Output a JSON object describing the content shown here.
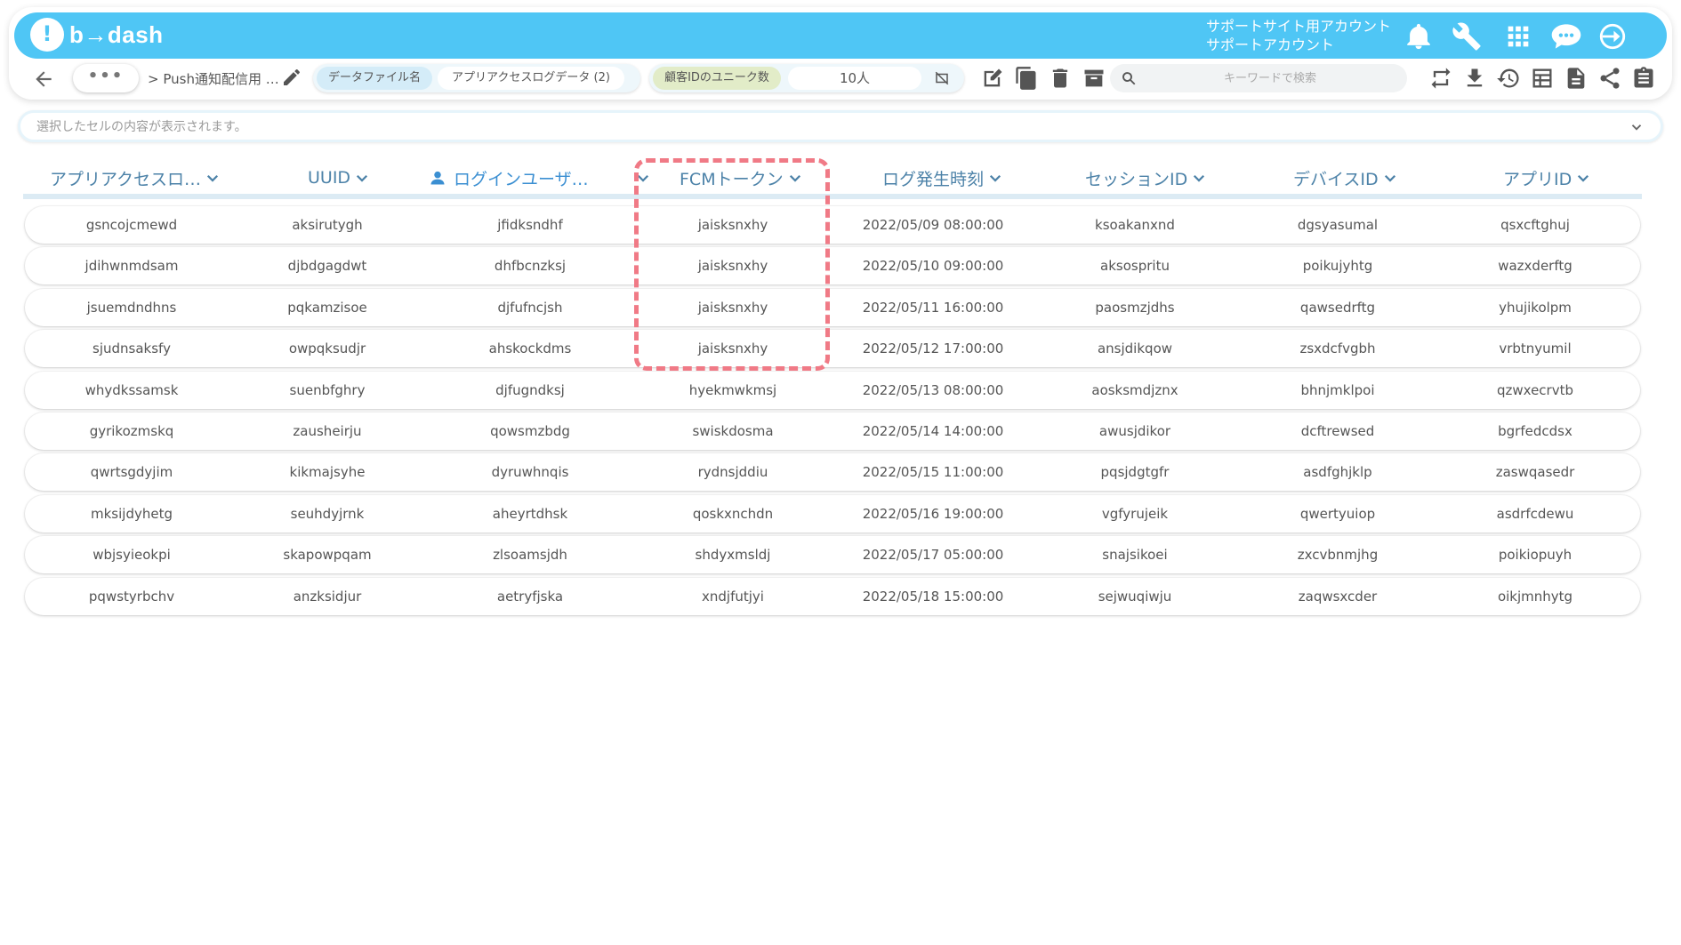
{
  "app": {
    "logo_text": "b→dash",
    "account_line1": "サポートサイト用アカウント",
    "account_line2": "サポートアカウント"
  },
  "header_icons": [
    "bell-icon",
    "wrench-icon",
    "apps-grid-icon",
    "chat-icon",
    "logout-icon"
  ],
  "toolbar": {
    "more_label": "•••",
    "breadcrumb": "> Push通知配信用 …",
    "pill_data_file_label": "データファイル名",
    "pill_data_file_value": "アプリアクセスログデータ (2)",
    "pill_unique_label": "顧客IDのユニーク数",
    "pill_unique_value": "10人",
    "search_placeholder": "キーワードで検索"
  },
  "cell_bar": {
    "placeholder": "選択したセルの内容が表示されます。"
  },
  "columns": [
    "アプリアクセスロ…",
    "UUID",
    "ログインユーザ…",
    "FCMトークン",
    "ログ発生時刻",
    "セッションID",
    "デバイスID",
    "アプリID"
  ],
  "rows": [
    [
      "gsncojcmewd",
      "aksirutygh",
      "jfidksndhf",
      "jaisksnxhy",
      "2022/05/09 08:00:00",
      "ksoakanxnd",
      "dgsyasumal",
      "qsxcftghuj"
    ],
    [
      "jdihwnmdsam",
      "djbdgagdwt",
      "dhfbcnzksj",
      "jaisksnxhy",
      "2022/05/10 09:00:00",
      "aksospritu",
      "poikujyhtg",
      "wazxderftg"
    ],
    [
      "jsuemdndhns",
      "pqkamzisoe",
      "djfufncjsh",
      "jaisksnxhy",
      "2022/05/11 16:00:00",
      "paosmzjdhs",
      "qawsedrftg",
      "yhujikolpm"
    ],
    [
      "sjudnsaksfy",
      "owpqksudjr",
      "ahskockdms",
      "jaisksnxhy",
      "2022/05/12 17:00:00",
      "ansjdikqow",
      "zsxdcfvgbh",
      "vrbtnyumil"
    ],
    [
      "whydkssamsk",
      "suenbfghry",
      "djfugndksj",
      "hyekmwkmsj",
      "2022/05/13 08:00:00",
      "aosksmdjznx",
      "bhnjmklpoi",
      "qzwxecrvtb"
    ],
    [
      "gyrikozmskq",
      "zausheirju",
      "qowsmzbdg",
      "swiskdosma",
      "2022/05/14 14:00:00",
      "awusjdikor",
      "dcftrewsed",
      "bgrfedcdsx"
    ],
    [
      "qwrtsgdyjim",
      "kikmajsyhe",
      "dyruwhnqis",
      "rydnsjddiu",
      "2022/05/15 11:00:00",
      "pqsjdgtgfr",
      "asdfghjklp",
      "zaswqasedr"
    ],
    [
      "mksijdyhetg",
      "seuhdyjrnk",
      "aheyrtdhsk",
      "qoskxnchdn",
      "2022/05/16 19:00:00",
      "vgfyrujeik",
      "qwertyuiop",
      "asdrfcdewu"
    ],
    [
      "wbjsyieokpi",
      "skapowpqam",
      "zlsoamsjdh",
      "shdyxmsldj",
      "2022/05/17 05:00:00",
      "snajsikoei",
      "zxcvbnmjhg",
      "poikiopuyh"
    ],
    [
      "pqwstyrbchv",
      "anzksidjur",
      "aetryfjska",
      "xndjfutjyi",
      "2022/05/18 15:00:00",
      "sejwuqiwju",
      "zaqwsxcder",
      "oikjmnhytg"
    ]
  ],
  "colors": {
    "header_bg": "#4fc6f5",
    "column_text": "#4c82a8",
    "highlight": "#f07a86"
  }
}
